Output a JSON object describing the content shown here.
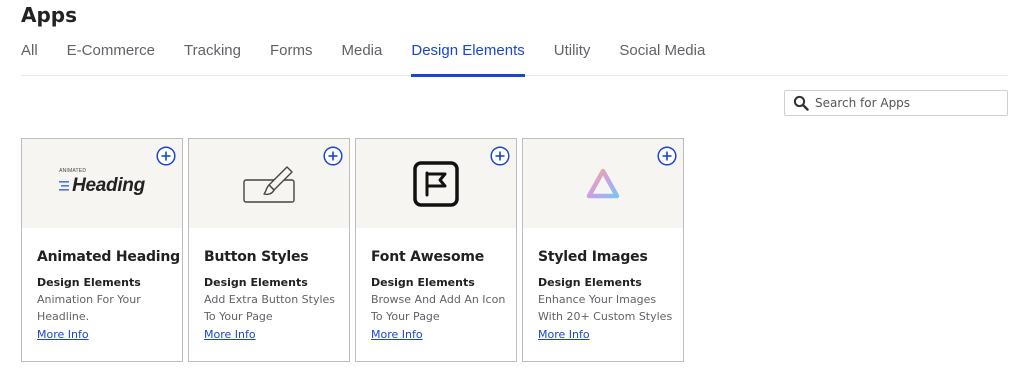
{
  "header": {
    "title": "Apps"
  },
  "tabs": [
    {
      "label": "All",
      "active": false
    },
    {
      "label": "E-Commerce",
      "active": false
    },
    {
      "label": "Tracking",
      "active": false
    },
    {
      "label": "Forms",
      "active": false
    },
    {
      "label": "Media",
      "active": false
    },
    {
      "label": "Design Elements",
      "active": true
    },
    {
      "label": "Utility",
      "active": false
    },
    {
      "label": "Social Media",
      "active": false
    }
  ],
  "search": {
    "placeholder": "Search for Apps",
    "value": "",
    "icon": "search-icon"
  },
  "colors": {
    "accent": "#1a44d6",
    "card_media_bg": "#f7f5f2",
    "border": "#bdbdbd"
  },
  "cards": [
    {
      "title": "Animated Heading",
      "category": "Design Elements",
      "description": "Animation For Your Headline.",
      "link": "More Info",
      "icon": "animated-heading-logo",
      "logo_small": "ANIMATED",
      "logo_text": "Heading"
    },
    {
      "title": "Button Styles",
      "category": "Design Elements",
      "description": "Add Extra Button Styles To Your Page",
      "link": "More Info",
      "icon": "button-brush-icon"
    },
    {
      "title": "Font Awesome",
      "category": "Design Elements",
      "description": "Browse And Add An Icon To Your Page",
      "link": "More Info",
      "icon": "font-awesome-flag-icon"
    },
    {
      "title": "Styled Images",
      "category": "Design Elements",
      "description": "Enhance Your Images With 20+ Custom Styles",
      "link": "More Info",
      "icon": "gradient-triangle-icon"
    }
  ]
}
